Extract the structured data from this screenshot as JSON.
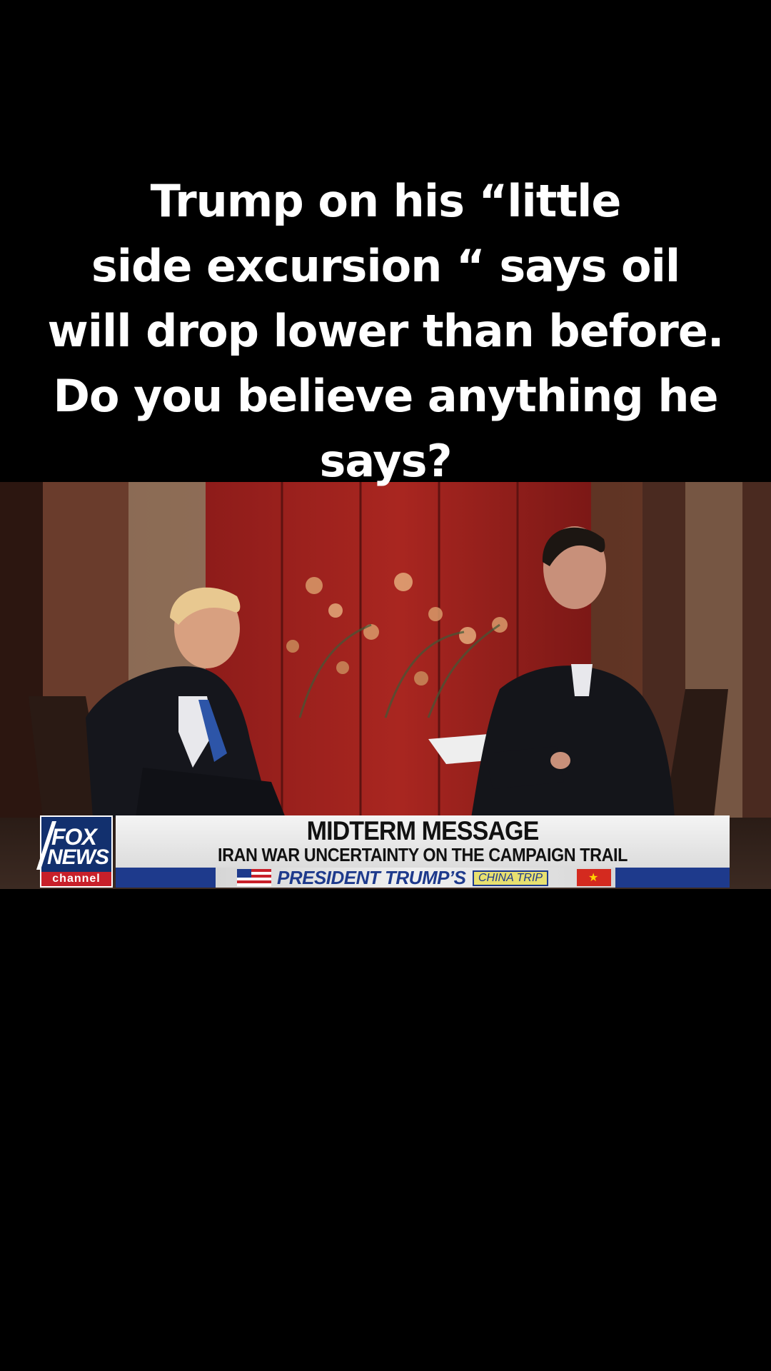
{
  "caption": {
    "lines": [
      "Trump on his “little",
      "side excursion “ says oil",
      "will drop lower than before.",
      "Do you believe anything he",
      "says?"
    ]
  },
  "broadcast": {
    "logo": {
      "top": "FOX",
      "bottom": "NEWS",
      "sub": "channel"
    },
    "headline": "MIDTERM MESSAGE",
    "subheadline": "IRAN WAR UNCERTAINTY ON THE CAMPAIGN TRAIL",
    "strip_text": "PRESIDENT TRUMP’S",
    "strip_tag": "CHINA TRIP"
  },
  "colors": {
    "background": "#000000",
    "caption_text": "#ffffff",
    "fox_blue": "#12306e",
    "fox_red": "#c8202a",
    "strip_blue": "#1e3a8c"
  }
}
